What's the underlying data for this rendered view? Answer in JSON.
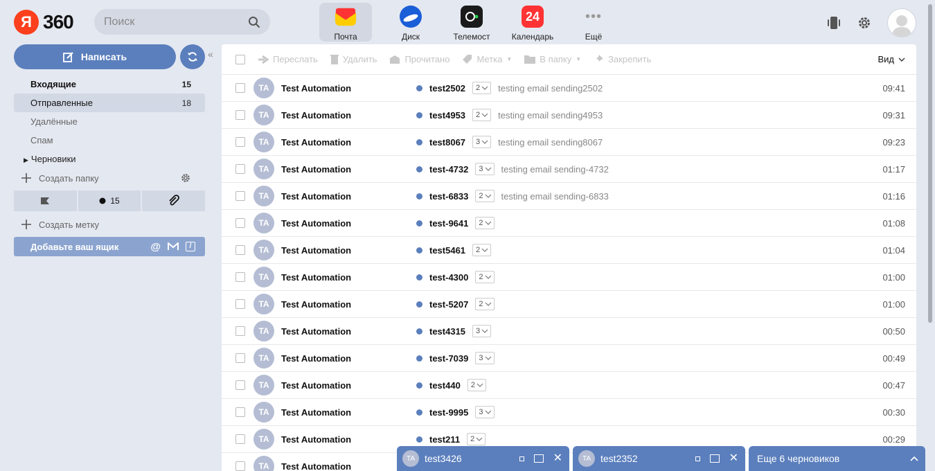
{
  "header": {
    "logo_mark": "Я",
    "logo_text": "360",
    "search_placeholder": "Поиск",
    "services": [
      {
        "label": "Почта"
      },
      {
        "label": "Диск"
      },
      {
        "label": "Телемост"
      },
      {
        "label": "Календарь",
        "badge": "24"
      },
      {
        "label": "Ещё"
      }
    ]
  },
  "sidebar": {
    "compose_label": "Написать",
    "folders": [
      {
        "label": "Входящие",
        "count": "15"
      },
      {
        "label": "Отправленные",
        "count": "18"
      },
      {
        "label": "Удалённые",
        "count": ""
      },
      {
        "label": "Спам",
        "count": ""
      },
      {
        "label": "Черновики",
        "count": ""
      }
    ],
    "create_folder": "Создать папку",
    "unread_count": "15",
    "create_label": "Создать метку",
    "add_mailbox": "Добавьте ваш ящик"
  },
  "toolbar": {
    "forward": "Переслать",
    "delete": "Удалить",
    "read": "Прочитано",
    "label": "Метка",
    "to_folder": "В папку",
    "pin": "Закрепить",
    "view": "Вид"
  },
  "messages": [
    {
      "initials": "TA",
      "sender": "Test Automation",
      "subject": "test2502",
      "thread": "2",
      "snippet": "testing email sending2502",
      "time": "09:41"
    },
    {
      "initials": "TA",
      "sender": "Test Automation",
      "subject": "test4953",
      "thread": "2",
      "snippet": "testing email sending4953",
      "time": "09:31"
    },
    {
      "initials": "TA",
      "sender": "Test Automation",
      "subject": "test8067",
      "thread": "3",
      "snippet": "testing email sending8067",
      "time": "09:23"
    },
    {
      "initials": "TA",
      "sender": "Test Automation",
      "subject": "test-4732",
      "thread": "3",
      "snippet": "testing email sending-4732",
      "time": "01:17"
    },
    {
      "initials": "TA",
      "sender": "Test Automation",
      "subject": "test-6833",
      "thread": "2",
      "snippet": "testing email sending-6833",
      "time": "01:16"
    },
    {
      "initials": "TA",
      "sender": "Test Automation",
      "subject": "test-9641",
      "thread": "2",
      "snippet": "",
      "time": "01:08"
    },
    {
      "initials": "TA",
      "sender": "Test Automation",
      "subject": "test5461",
      "thread": "2",
      "snippet": "",
      "time": "01:04"
    },
    {
      "initials": "TA",
      "sender": "Test Automation",
      "subject": "test-4300",
      "thread": "2",
      "snippet": "",
      "time": "01:00"
    },
    {
      "initials": "TA",
      "sender": "Test Automation",
      "subject": "test-5207",
      "thread": "2",
      "snippet": "",
      "time": "01:00"
    },
    {
      "initials": "TA",
      "sender": "Test Automation",
      "subject": "test4315",
      "thread": "3",
      "snippet": "",
      "time": "00:50"
    },
    {
      "initials": "TA",
      "sender": "Test Automation",
      "subject": "test-7039",
      "thread": "3",
      "snippet": "",
      "time": "00:49"
    },
    {
      "initials": "TA",
      "sender": "Test Automation",
      "subject": "test440",
      "thread": "2",
      "snippet": "",
      "time": "00:47"
    },
    {
      "initials": "TA",
      "sender": "Test Automation",
      "subject": "test-9995",
      "thread": "3",
      "snippet": "",
      "time": "00:30"
    },
    {
      "initials": "TA",
      "sender": "Test Automation",
      "subject": "test211",
      "thread": "2",
      "snippet": "",
      "time": "00:29"
    },
    {
      "initials": "TA",
      "sender": "Test Automation",
      "subject": "",
      "thread": "",
      "snippet": "",
      "time": ""
    }
  ],
  "drafts": [
    {
      "initials": "TA",
      "subject": "test3426"
    },
    {
      "initials": "TA",
      "subject": "test2352"
    }
  ],
  "more_drafts": "Еще 6 черновиков",
  "colors": {
    "accent": "#5b7fbd",
    "background": "#e4e8f0",
    "brand": "#fc3f1d"
  }
}
